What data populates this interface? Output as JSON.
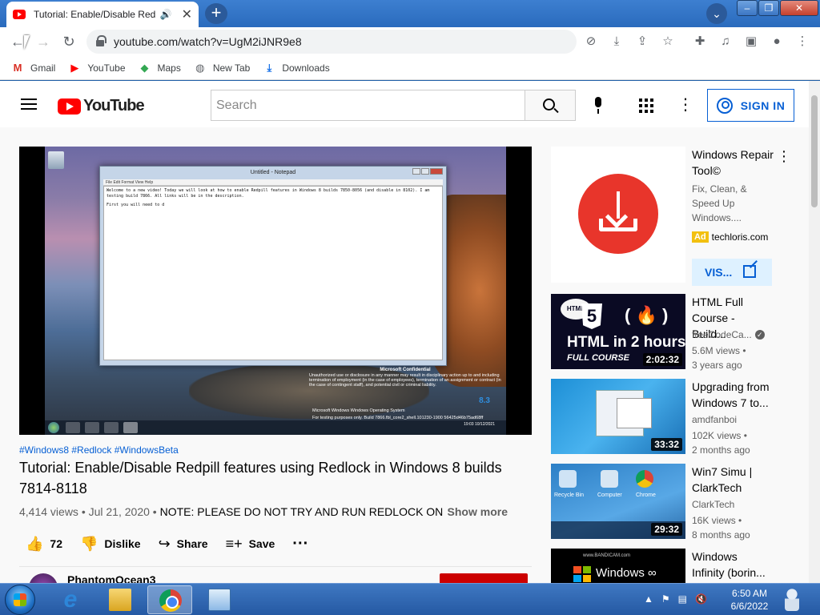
{
  "browser": {
    "tab": {
      "title": "Tutorial: Enable/Disable Redpill features",
      "speaker": "🔊",
      "close": "✕"
    },
    "new_tab": "+",
    "tab_search": "⌄",
    "window_buttons": {
      "minimize": "–",
      "maximize": "❐",
      "close": "✕"
    },
    "nav": {
      "back": "←",
      "forward": "→",
      "reload": "↻"
    },
    "url": "youtube.com/watch?v=UgM2iJNR9e8",
    "toolbar_icons": {
      "cookie": "⊘",
      "install": "⤓",
      "share": "⇪",
      "bookmark": "☆",
      "extensions": "✚",
      "media": "♫",
      "sidebar": "▣",
      "profile": "●",
      "menu": "⋮"
    },
    "bookmarks": [
      {
        "label": "Gmail",
        "icon": "M",
        "color": "#d93025"
      },
      {
        "label": "YouTube",
        "icon": "▶",
        "color": "#ff0000"
      },
      {
        "label": "Maps",
        "icon": "◆",
        "color": "#34a853"
      },
      {
        "label": "New Tab",
        "icon": "◍",
        "color": "#5f6368"
      },
      {
        "label": "Downloads",
        "icon": "⤓",
        "color": "#1a73e8"
      }
    ]
  },
  "youtube": {
    "logo_text": "YouTube",
    "search": {
      "placeholder": "Search",
      "value": ""
    },
    "sign_in": "SIGN IN",
    "more": "⋮"
  },
  "player": {
    "notepad_title": "Untitled - Notepad",
    "notepad_menu": "File  Edit  Format  View  Help",
    "notepad_text": "Welcome to a new video! Today we will look at how to enable Redpill features in Windows 8 builds 7850-8056 (and disable in 8102). I am testing build 7866. All links will be in the description.",
    "notepad_text2": "First you will need to d",
    "confidential_heading": "Microsoft Confidential",
    "confidential_text": "Unauthorized use or disclosure in any manner may result in disciplinary action up to and including termination of employment (in the case of employees), termination of an assignment or contract (in the case of contingent staff), and potential civil or criminal liability.",
    "build_line": "For testing purposes only. Build 7866.fbl_core2_shell.101230-1900 56425d46b75ad68ff",
    "os_line": "Microsoft Windows Windows Operating System",
    "watermark": "8.3",
    "inner_clock": "19:03\n10/12/2021"
  },
  "video": {
    "hashtags": "#Windows8 #Redlock #WindowsBeta",
    "title": "Tutorial: Enable/Disable Redpill features using Redlock in Windows 8 builds 7814-8118",
    "views_date": "4,414 views • Jul 21, 2020 • ",
    "description_snippet": "NOTE: PLEASE DO NOT TRY AND RUN REDLOCK ON YOUR",
    "show_more": "Show more",
    "actions": {
      "like_count": "72",
      "dislike": "Dislike",
      "share": "Share",
      "save": "Save",
      "more": "···"
    },
    "channel": {
      "name": "PhantomOcean3"
    }
  },
  "sidebar": {
    "ad": {
      "title": "Windows Repair Tool©",
      "description": "Fix, Clean, & Speed Up Windows....",
      "badge": "Ad",
      "domain": "techloris.com",
      "visit": "VIS..."
    },
    "recommendations": [
      {
        "title": "HTML Full Course - Build...",
        "channel": "freeCodeCa...",
        "verified": true,
        "views": "5.6M views •",
        "age": "3 years ago",
        "duration": "2:02:32",
        "thumb_badge": "HTML",
        "thumb_big": "HTML in 2 hours",
        "thumb_sub": "FULL COURSE"
      },
      {
        "title": "Upgrading from Windows 7 to...",
        "channel": "amdfanboi",
        "verified": false,
        "views": "102K views •",
        "age": "2 months ago",
        "duration": "33:32"
      },
      {
        "title": "Win7 Simu | ClarkTech",
        "channel": "ClarkTech",
        "verified": false,
        "views": "16K views •",
        "age": "8 months ago",
        "duration": "29:32",
        "thumb_labels": [
          "Recycle Bin",
          "Computer",
          "Chrome"
        ]
      },
      {
        "title": "Windows Infinity (borin...",
        "channel": "",
        "verified": false,
        "views": "",
        "age": "",
        "duration": "",
        "thumb_top": "www.BANDICAM.com",
        "thumb_text": "Windows ∞"
      }
    ]
  },
  "taskbar": {
    "apps": [
      "Internet Explorer",
      "Windows Explorer",
      "Google Chrome",
      "Remote Desktop"
    ],
    "tray_icons": [
      "▲",
      "⚑",
      "▤",
      "🔇"
    ],
    "time": "6:50 AM",
    "date": "6/6/2022"
  }
}
